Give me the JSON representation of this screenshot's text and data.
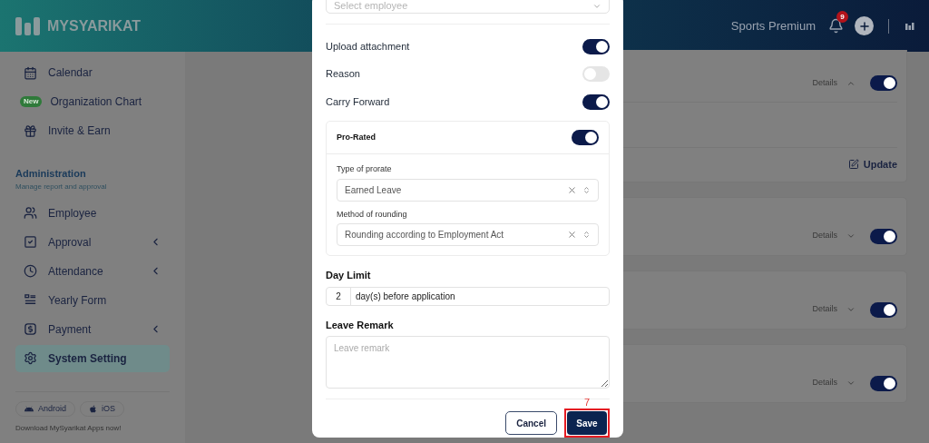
{
  "header": {
    "brand": "MYSYARIKAT",
    "company": "Sports Premium",
    "notification_count": "9"
  },
  "sidebar": {
    "top_items": [
      {
        "label": "Calendar",
        "selected": false
      },
      {
        "label": "Organization Chart",
        "badge": "New",
        "selected": false
      },
      {
        "label": "Invite & Earn",
        "selected": false
      }
    ],
    "section": {
      "title": "Administration",
      "subtitle": "Manage report and approval"
    },
    "items": [
      {
        "label": "Employee",
        "has_submenu": false,
        "selected": false
      },
      {
        "label": "Approval",
        "has_submenu": true,
        "selected": false
      },
      {
        "label": "Attendance",
        "has_submenu": true,
        "selected": false
      },
      {
        "label": "Yearly Form",
        "has_submenu": false,
        "selected": false
      },
      {
        "label": "Payment",
        "has_submenu": true,
        "selected": false
      },
      {
        "label": "System Setting",
        "has_submenu": false,
        "selected": true
      }
    ],
    "apps": [
      {
        "label": "Android",
        "kind": "android"
      },
      {
        "label": "iOS",
        "kind": "apple"
      }
    ],
    "download_text": "Download MySyarikat Apps now!"
  },
  "cards": [
    {
      "details": "Details",
      "expanded": true,
      "on": true,
      "action": "Update"
    },
    {
      "details": "Details",
      "expanded": false,
      "on": true
    },
    {
      "details": "Details",
      "expanded": false,
      "on": true
    },
    {
      "details": "Details",
      "expanded": false,
      "on": true
    }
  ],
  "modal": {
    "select_placeholder": "Select employee",
    "toggles": [
      {
        "label": "Upload attachment",
        "on": true
      },
      {
        "label": "Reason",
        "on": false
      },
      {
        "label": "Carry Forward",
        "on": true
      }
    ],
    "prorated": {
      "label": "Pro-Rated",
      "on": true,
      "fields": [
        {
          "label": "Type of prorate",
          "value": "Earned Leave"
        },
        {
          "label": "Method of rounding",
          "value": "Rounding according to Employment Act"
        }
      ]
    },
    "day_limit": {
      "label": "Day Limit",
      "value": "2",
      "suffix": "day(s) before application"
    },
    "remark": {
      "label": "Leave Remark",
      "placeholder": "Leave remark"
    },
    "cancel": "Cancel",
    "save": "Save",
    "step_marker": "7"
  }
}
